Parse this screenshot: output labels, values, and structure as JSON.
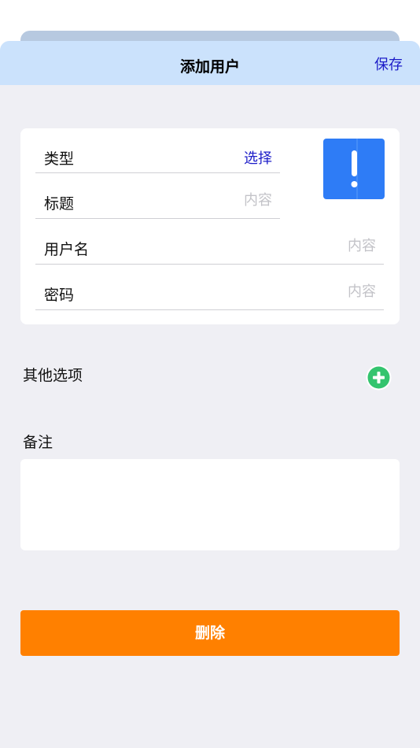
{
  "nav": {
    "title": "添加用户",
    "save_label": "保存"
  },
  "form": {
    "type_label": "类型",
    "type_action": "选择",
    "title_label": "标题",
    "title_placeholder": "内容",
    "username_label": "用户名",
    "username_placeholder": "内容",
    "password_label": "密码",
    "password_placeholder": "内容",
    "type_icon": "exclamation-icon"
  },
  "other_options": {
    "label": "其他选项",
    "add_icon": "plus-circle-icon"
  },
  "notes": {
    "label": "备注",
    "value": ""
  },
  "actions": {
    "delete_label": "删除"
  },
  "colors": {
    "nav_background": "#cbe2fc",
    "accent_link": "#1c1cc8",
    "icon_tile": "#2e7cf6",
    "add_button": "#34c46e",
    "delete_button": "#ff8000",
    "page_background": "#efeff4"
  }
}
